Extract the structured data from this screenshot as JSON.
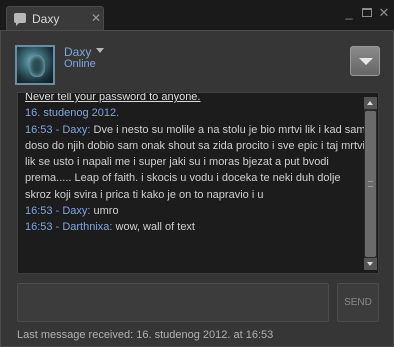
{
  "tab": {
    "title": "Daxy",
    "close": "✕",
    "icon": "chat-bubble-icon"
  },
  "window_controls": {
    "minimize": "_",
    "maximize": "",
    "close": "✕"
  },
  "friend": {
    "name": "Daxy",
    "status": "Online"
  },
  "chat": {
    "warning": "Never tell your password to anyone.",
    "date": "16. studenog 2012.",
    "messages": [
      {
        "time": "16:53",
        "sender": "Daxy",
        "text": "Dve i nesto su molile a na stolu je bio mrtvi lik i kad sam doso do njih dobio sam onak shout sa zida procito i sve epic i taj mrtvi lik se usto i napali me i super jaki su i moras bjezat a put bvodi prema..... Leap of faith. i skocis u vodu i doceka te neki duh dolje skroz koji svira i prica ti kako je on to napravio i u"
      },
      {
        "time": "16:53",
        "sender": "Daxy",
        "text": "umro"
      },
      {
        "time": "16:53",
        "sender": "Darthnixa",
        "text": "wow, wall of text"
      }
    ]
  },
  "input": {
    "value": "",
    "placeholder": ""
  },
  "send_label": "SEND",
  "footer": {
    "text": "Last message received: 16. studenog 2012. at 16:53"
  },
  "colors": {
    "accent": "#7fa6e0",
    "background": "#363636",
    "log_background": "#1c1c1c"
  }
}
